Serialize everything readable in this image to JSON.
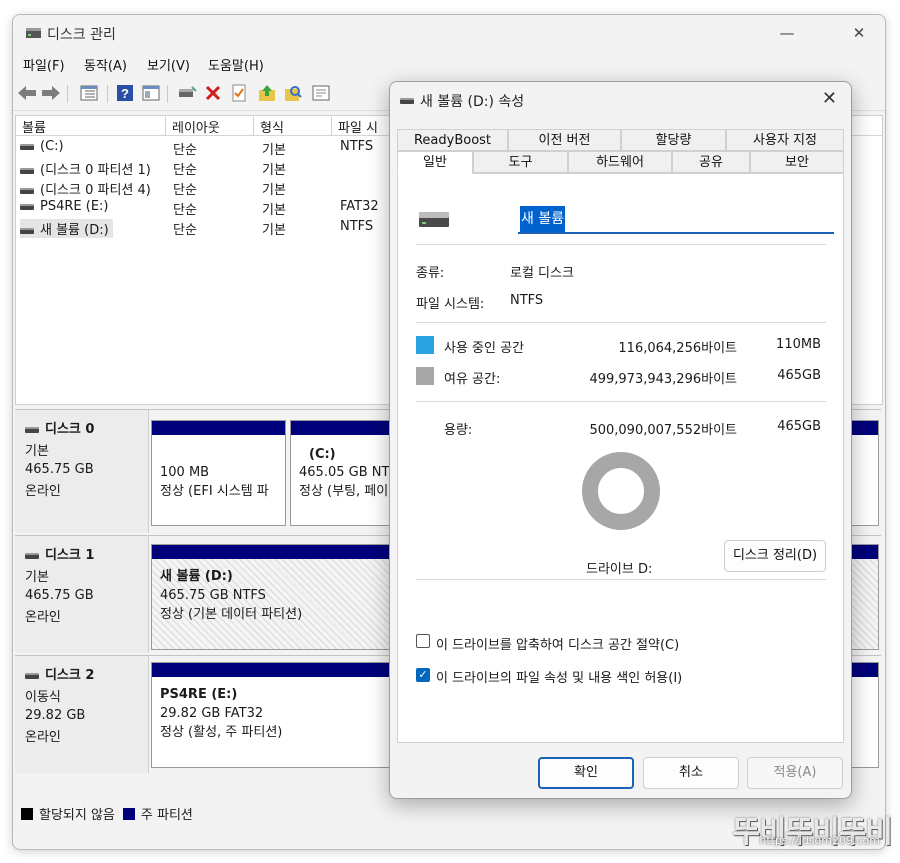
{
  "window": {
    "title": "디스크 관리",
    "controls": [
      "—",
      "☐",
      "✕"
    ]
  },
  "menu": [
    "파일(F)",
    "동작(A)",
    "보기(V)",
    "도움말(H)"
  ],
  "volume_list": {
    "columns": [
      "볼륨",
      "레이아웃",
      "형식",
      "파일 시"
    ],
    "rows": [
      {
        "name": "(C:)",
        "layout": "단순",
        "type": "기본",
        "fs": "NTFS"
      },
      {
        "name": "(디스크 0 파티션 1)",
        "layout": "단순",
        "type": "기본",
        "fs": ""
      },
      {
        "name": "(디스크 0 파티션 4)",
        "layout": "단순",
        "type": "기본",
        "fs": ""
      },
      {
        "name": "PS4RE (E:)",
        "layout": "단순",
        "type": "기본",
        "fs": "FAT32"
      },
      {
        "name": "새 볼륨 (D:)",
        "layout": "단순",
        "type": "기본",
        "fs": "NTFS"
      }
    ]
  },
  "disks": [
    {
      "name": "디스크 0",
      "kind": "기본",
      "size": "465.75 GB",
      "status": "온라인",
      "partitions": [
        {
          "title": "",
          "line1": "100 MB",
          "line2": "정상 (EFI 시스템 파"
        },
        {
          "title": "(C:)",
          "line1": "465.05 GB NTF",
          "line2": "정상 (부팅, 페이"
        }
      ]
    },
    {
      "name": "디스크 1",
      "kind": "기본",
      "size": "465.75 GB",
      "status": "온라인",
      "partitions": [
        {
          "title": "새 볼륨  (D:)",
          "line1": "465.75 GB NTFS",
          "line2": "정상 (기본 데이터 파티션)"
        }
      ]
    },
    {
      "name": "디스크 2",
      "kind": "이동식",
      "size": "29.82 GB",
      "status": "온라인",
      "partitions": [
        {
          "title": "PS4RE  (E:)",
          "line1": "29.82 GB FAT32",
          "line2": "정상 (활성, 주 파티션)"
        }
      ]
    }
  ],
  "legend": {
    "unallocated": "할당되지 않음",
    "primary": "주 파티션"
  },
  "dialog": {
    "title": "새 볼륨 (D:) 속성",
    "tabs_row1": [
      "ReadyBoost",
      "이전 버전",
      "할당량",
      "사용자 지정"
    ],
    "tabs_row2": [
      "일반",
      "도구",
      "하드웨어",
      "공유",
      "보안"
    ],
    "volume_name": "새 볼륨",
    "type_label": "종류:",
    "type_value": "로컬 디스크",
    "fs_label": "파일 시스템:",
    "fs_value": "NTFS",
    "used_label": "사용 중인 공간",
    "used_bytes": "116,064,256바이트",
    "used_size": "110MB",
    "free_label": "여유 공간:",
    "free_bytes": "499,973,943,296바이트",
    "free_size": "465GB",
    "capacity_label": "용량:",
    "capacity_bytes": "500,090,007,552바이트",
    "capacity_size": "465GB",
    "drive_label": "드라이브 D:",
    "cleanup_button": "디스크 정리(D)",
    "compress_label": "이 드라이브를 압축하여 디스크 공간 절약(C)",
    "index_label": "이 드라이브의 파일 속성 및 내용 색인 허용(I)",
    "ok": "확인",
    "cancel": "취소",
    "apply": "적용(A)",
    "used_color": "#2aa1e0",
    "free_color": "#a7a7a7"
  },
  "watermark": {
    "text": "뚜비뚜비뚜비",
    "url": "https://idsom209.com"
  }
}
